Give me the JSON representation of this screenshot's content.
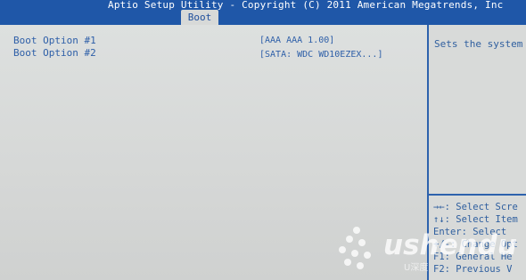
{
  "header": {
    "title": "Aptio Setup Utility - Copyright (C) 2011 American Megatrends, Inc",
    "active_tab": "Boot"
  },
  "main": {
    "options": [
      {
        "label": "Boot Option #1",
        "value": "[AAA AAA 1.00]"
      },
      {
        "label": "Boot Option #2",
        "value": "[SATA: WDC WD10EZEX...]"
      }
    ]
  },
  "help": {
    "text": "Sets the system",
    "keys": [
      "→←: Select Scre",
      "↑↓: Select Item",
      "Enter: Select",
      "+/-: Change Opt",
      "F1: General He",
      "F2: Previous V"
    ]
  },
  "watermark": {
    "text": "ushendu",
    "subtext": "U深度"
  },
  "colors": {
    "header_bg": "#1f57a8",
    "screen_bg": "#d7d9d8",
    "text_blue": "#2e5fa8"
  }
}
